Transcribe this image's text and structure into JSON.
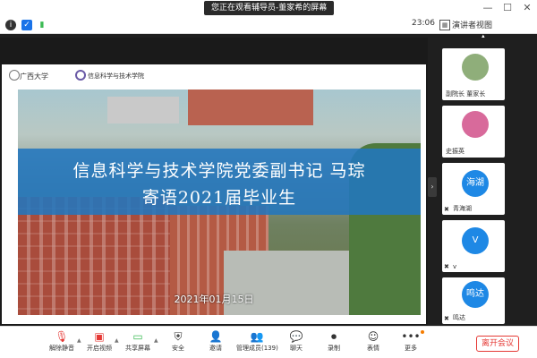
{
  "window": {
    "viewing_banner": "您正在观看辅导员-董家希的屏幕",
    "min_btn": "—",
    "max_btn": "☐",
    "close_btn": "✕"
  },
  "status": {
    "clock": "23:06",
    "view_mode": "演讲者视图"
  },
  "slide": {
    "logo1": "广西大学",
    "logo2": "信息科学与技术学院",
    "title_line1": "信息科学与技术学院党委副书记 马琮",
    "title_line2": "寄语2021届毕业生",
    "date": "2021年01月15日"
  },
  "participants": [
    {
      "name": "副院长 董家长",
      "initials": ""
    },
    {
      "name": "史振英",
      "initials": ""
    },
    {
      "name": "青海湖",
      "initials": "海湖"
    },
    {
      "name": "v",
      "initials": "V"
    },
    {
      "name": "鸣达",
      "initials": "鸣达"
    }
  ],
  "toolbar": {
    "mute": "解除静音",
    "video": "开启视频",
    "share": "共享屏幕",
    "security": "安全",
    "invite": "邀请",
    "members": "管理成员(139)",
    "chat": "聊天",
    "record": "录制",
    "reactions": "表情",
    "more": "更多",
    "leave": "离开会议"
  }
}
